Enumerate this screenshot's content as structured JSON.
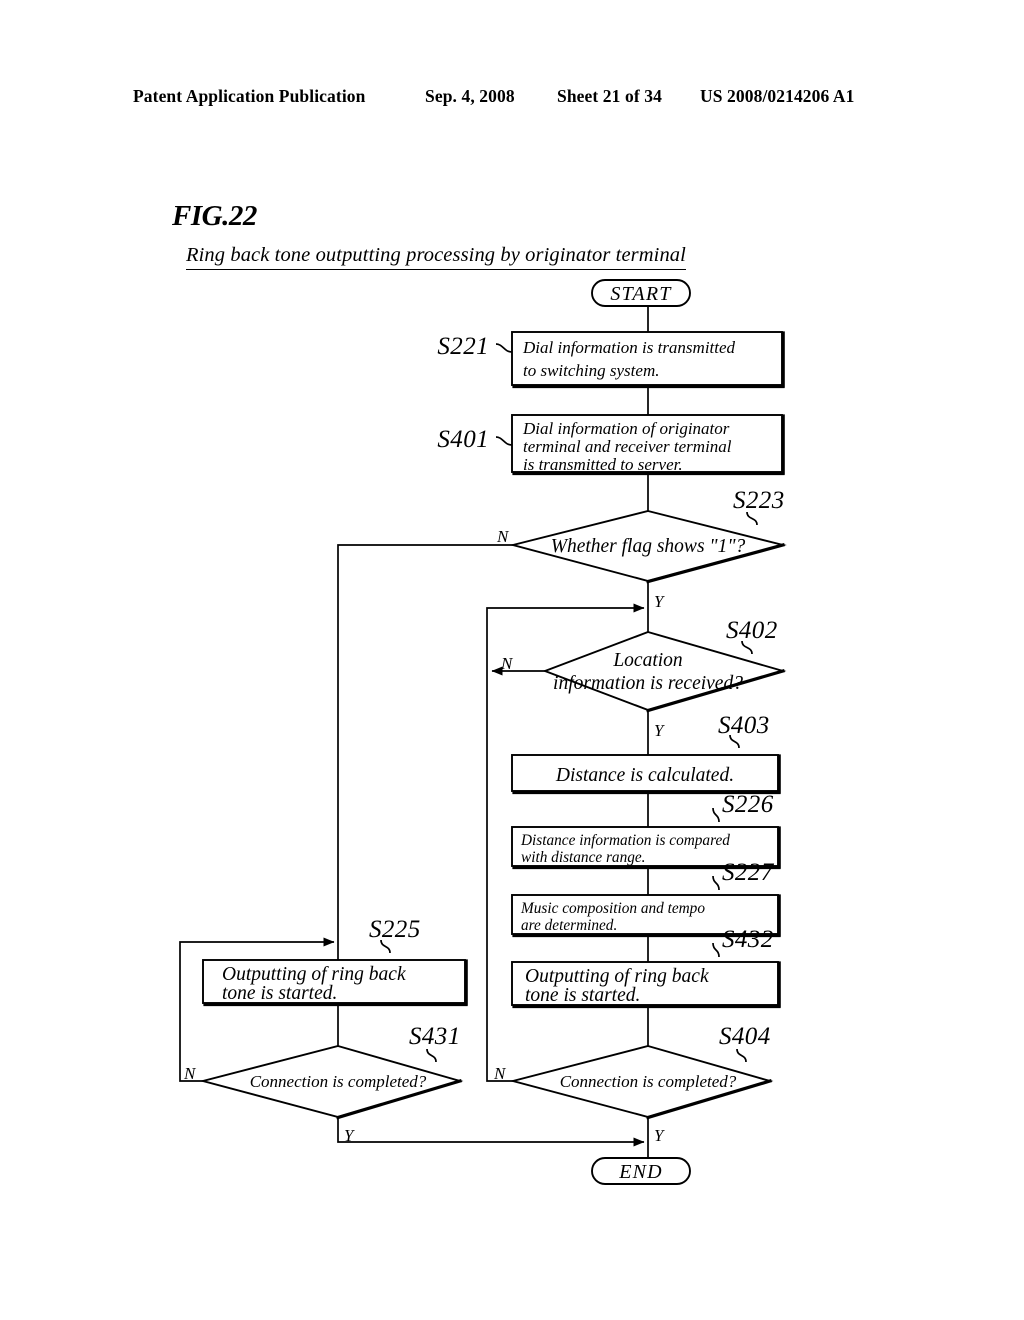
{
  "header": {
    "publication": "Patent Application Publication",
    "date": "Sep. 4, 2008",
    "sheet": "Sheet 21 of 34",
    "number": "US 2008/0214206 A1"
  },
  "figure": {
    "label": "FIG.22",
    "caption": "Ring back tone outputting processing by originator terminal"
  },
  "terminals": {
    "start": "START",
    "end": "END"
  },
  "steps": {
    "s221": {
      "tag": "S221",
      "text_line1": "Dial information is transmitted",
      "text_line2": "to switching system."
    },
    "s401": {
      "tag": "S401",
      "text_line1": "Dial information of originator",
      "text_line2": "terminal and receiver terminal",
      "text_line3": "is transmitted to server."
    },
    "s223": {
      "tag": "S223",
      "text": "Whether flag shows \"1\"?",
      "yes": "Y",
      "no": "N"
    },
    "s402": {
      "tag": "S402",
      "text_line1": "Location",
      "text_line2": "information is received?",
      "yes": "Y",
      "no": "N"
    },
    "s403": {
      "tag": "S403",
      "text": "Distance is calculated."
    },
    "s226": {
      "tag": "S226",
      "text_line1": "Distance information is compared",
      "text_line2": "with distance range."
    },
    "s227": {
      "tag": "S227",
      "text_line1": "Music composition and tempo",
      "text_line2": "are determined."
    },
    "s432": {
      "tag": "S432",
      "text_line1": "Outputting of ring back",
      "text_line2": "tone is started."
    },
    "s225": {
      "tag": "S225",
      "text_line1": "Outputting of ring back",
      "text_line2": "tone is started."
    },
    "s431": {
      "tag": "S431",
      "text": "Connection is completed?",
      "yes": "Y",
      "no": "N"
    },
    "s404": {
      "tag": "S404",
      "text": "Connection is completed?",
      "yes": "Y",
      "no": "N"
    }
  },
  "chart_data": {
    "type": "diagram",
    "title": "Ring back tone outputting processing by originator terminal",
    "nodes": [
      {
        "id": "start",
        "kind": "terminal",
        "label": "START"
      },
      {
        "id": "S221",
        "kind": "process",
        "label": "Dial information is transmitted to switching system."
      },
      {
        "id": "S401",
        "kind": "process",
        "label": "Dial information of originator terminal and receiver terminal is transmitted to server."
      },
      {
        "id": "S223",
        "kind": "decision",
        "label": "Whether flag shows \"1\"?"
      },
      {
        "id": "S402",
        "kind": "decision",
        "label": "Location information is received?"
      },
      {
        "id": "S403",
        "kind": "process",
        "label": "Distance is calculated."
      },
      {
        "id": "S226",
        "kind": "process",
        "label": "Distance information is compared with distance range."
      },
      {
        "id": "S227",
        "kind": "process",
        "label": "Music composition and tempo are determined."
      },
      {
        "id": "S432",
        "kind": "process",
        "label": "Outputting of ring back tone is started."
      },
      {
        "id": "S225",
        "kind": "process",
        "label": "Outputting of ring back tone is started."
      },
      {
        "id": "S431",
        "kind": "decision",
        "label": "Connection is completed?"
      },
      {
        "id": "S404",
        "kind": "decision",
        "label": "Connection is completed?"
      },
      {
        "id": "end",
        "kind": "terminal",
        "label": "END"
      }
    ],
    "edges": [
      {
        "from": "start",
        "to": "S221",
        "label": ""
      },
      {
        "from": "S221",
        "to": "S401",
        "label": ""
      },
      {
        "from": "S401",
        "to": "S223",
        "label": ""
      },
      {
        "from": "S223",
        "to": "S225",
        "label": "N"
      },
      {
        "from": "S223",
        "to": "S402",
        "label": "Y"
      },
      {
        "from": "S402",
        "to": "S403",
        "label": "Y"
      },
      {
        "from": "S402",
        "to": "S225",
        "label": "N"
      },
      {
        "from": "S403",
        "to": "S226",
        "label": ""
      },
      {
        "from": "S226",
        "to": "S227",
        "label": ""
      },
      {
        "from": "S227",
        "to": "S432",
        "label": ""
      },
      {
        "from": "S432",
        "to": "S404",
        "label": ""
      },
      {
        "from": "S225",
        "to": "S431",
        "label": ""
      },
      {
        "from": "S431",
        "to": "S225",
        "label": "N"
      },
      {
        "from": "S431",
        "to": "end",
        "label": "Y"
      },
      {
        "from": "S404",
        "to": "S402",
        "label": "N"
      },
      {
        "from": "S404",
        "to": "end",
        "label": "Y"
      }
    ]
  }
}
